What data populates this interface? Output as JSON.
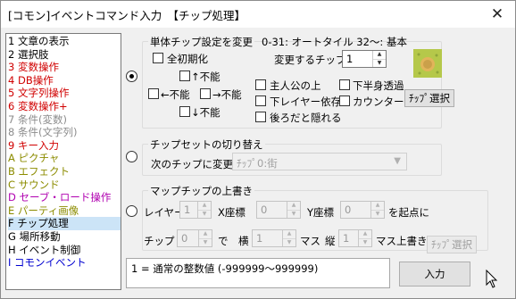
{
  "window": {
    "title": "[コモン]イベントコマンド入力　【チップ処理】",
    "close_glyph": "✕"
  },
  "command_list": [
    {
      "label": "1 文章の表示",
      "color": "#000000"
    },
    {
      "label": "2 選択肢",
      "color": "#000000"
    },
    {
      "label": "3 変数操作",
      "color": "#d00000"
    },
    {
      "label": "4 DB操作",
      "color": "#d00000"
    },
    {
      "label": "5 文字列操作",
      "color": "#d00000"
    },
    {
      "label": "6 変数操作+",
      "color": "#d00000"
    },
    {
      "label": "7 条件(変数)",
      "color": "#8c8c8c"
    },
    {
      "label": "8 条件(文字列)",
      "color": "#8c8c8c"
    },
    {
      "label": "9 キー入力",
      "color": "#d00000"
    },
    {
      "label": "A ピクチャ",
      "color": "#8c8c00"
    },
    {
      "label": "B エフェクト",
      "color": "#8c8c00"
    },
    {
      "label": "C サウンド",
      "color": "#8c8c00"
    },
    {
      "label": "D セーブ・ロード操作",
      "color": "#b000b0"
    },
    {
      "label": "E パーティ画像",
      "color": "#8c8c00"
    },
    {
      "label": "F チップ処理",
      "color": "#000000",
      "selected": true
    },
    {
      "label": "G 場所移動",
      "color": "#000000"
    },
    {
      "label": "H イベント制御",
      "color": "#000000"
    },
    {
      "label": "I コモンイベント",
      "color": "#0000d0"
    }
  ],
  "single_chip": {
    "legend": "単体チップ設定を変更",
    "range_info": "0-31: オートタイル 32～: 基本",
    "all_init_label": "全初期化",
    "up_label": "↑不能",
    "left_label": "←不能",
    "right_label": "→不能",
    "down_label": "↓不能",
    "change_chip_label": "変更するチップ",
    "chip_value": "1",
    "hero_above_label": "主人公の上",
    "lower_half_label": "下半身透過",
    "lower_layer_label": "下レイヤー依存",
    "counter_label": "カウンター",
    "hide_behind_label": "後ろだと隠れる",
    "chip_select_label": "ﾁｯﾌﾟ選択",
    "chip_preview_color": "#b7c94a",
    "selected": true
  },
  "chipset_switch": {
    "legend": "チップセットの切り替え",
    "next_chip_label": "次のチップに変更",
    "chip_dropdown": "ﾁｯﾌﾟ0:街",
    "selected": false
  },
  "map_overwrite": {
    "legend": "マップチップの上書き",
    "layer_label": "レイヤー",
    "layer_value": "1",
    "x_label": "X座標",
    "x_value": "0",
    "y_label": "Y座標",
    "y_value": "0",
    "origin_label": "を起点に",
    "chip_label": "チップ",
    "chip_value": "0",
    "de_label": "で",
    "width_label": "横",
    "width_value": "1",
    "mass1_label": "マス",
    "height_label": "縦",
    "height_value": "1",
    "mass_overwrite_label": "マス上書き",
    "chip_select_label": "ﾁｯﾌﾟ選択",
    "selected": false
  },
  "status_text": "1 = 通常の整数値 (-999999～999999)",
  "input_button_label": "入力"
}
